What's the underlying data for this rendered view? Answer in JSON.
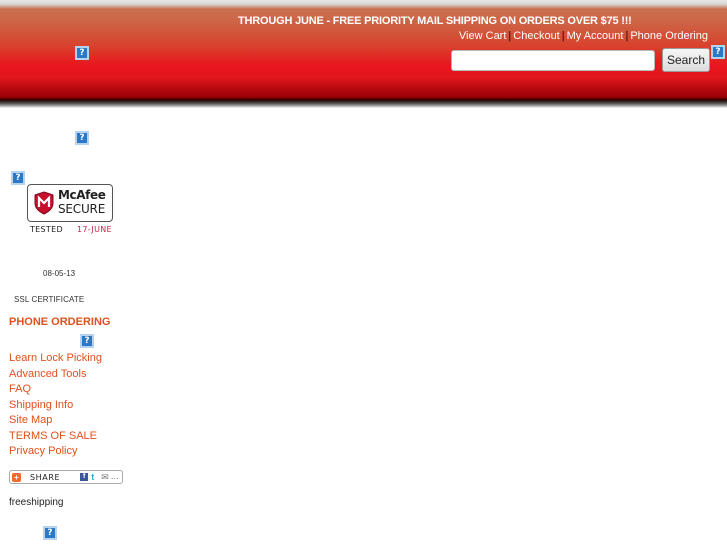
{
  "header": {
    "promo_text": "THROUGH JUNE - FREE PRIORITY MAIL SHIPPING ON ORDERS OVER $75 !!!",
    "links": [
      {
        "label": "View Cart"
      },
      {
        "label": "Checkout"
      },
      {
        "label": "My Account"
      },
      {
        "label": "Phone Ordering"
      }
    ],
    "separator": "|",
    "search": {
      "value": "",
      "placeholder": "",
      "button_label": "Search"
    },
    "broken_image_glyph": "?"
  },
  "sidebar": {
    "mcafee": {
      "brand": "McAfee",
      "secure": "SECURE",
      "tested_label": "TESTED",
      "tested_date": "17-JUNE",
      "shield_letter": "M"
    },
    "ssl": {
      "date": "08-05-13",
      "label": "SSL CERTIFICATE"
    },
    "phone_heading": "PHONE ORDERING",
    "nav_items": [
      {
        "label": "Learn Lock Picking"
      },
      {
        "label": "Advanced Tools"
      },
      {
        "label": "FAQ"
      },
      {
        "label": "Shipping Info"
      },
      {
        "label": "Site Map"
      },
      {
        "label": "TERMS OF SALE"
      },
      {
        "label": "Privacy Policy"
      }
    ],
    "share": {
      "label": "SHARE",
      "plus_glyph": "+",
      "facebook_glyph": "f",
      "twitter_glyph": "t",
      "mail_glyph": "✉",
      "more_glyph": "…"
    },
    "freeshipping": "freeshipping"
  },
  "colors": {
    "link_orange": "#e0501c",
    "header_red": "#e8171e",
    "mcafee_red": "#d0224d"
  }
}
